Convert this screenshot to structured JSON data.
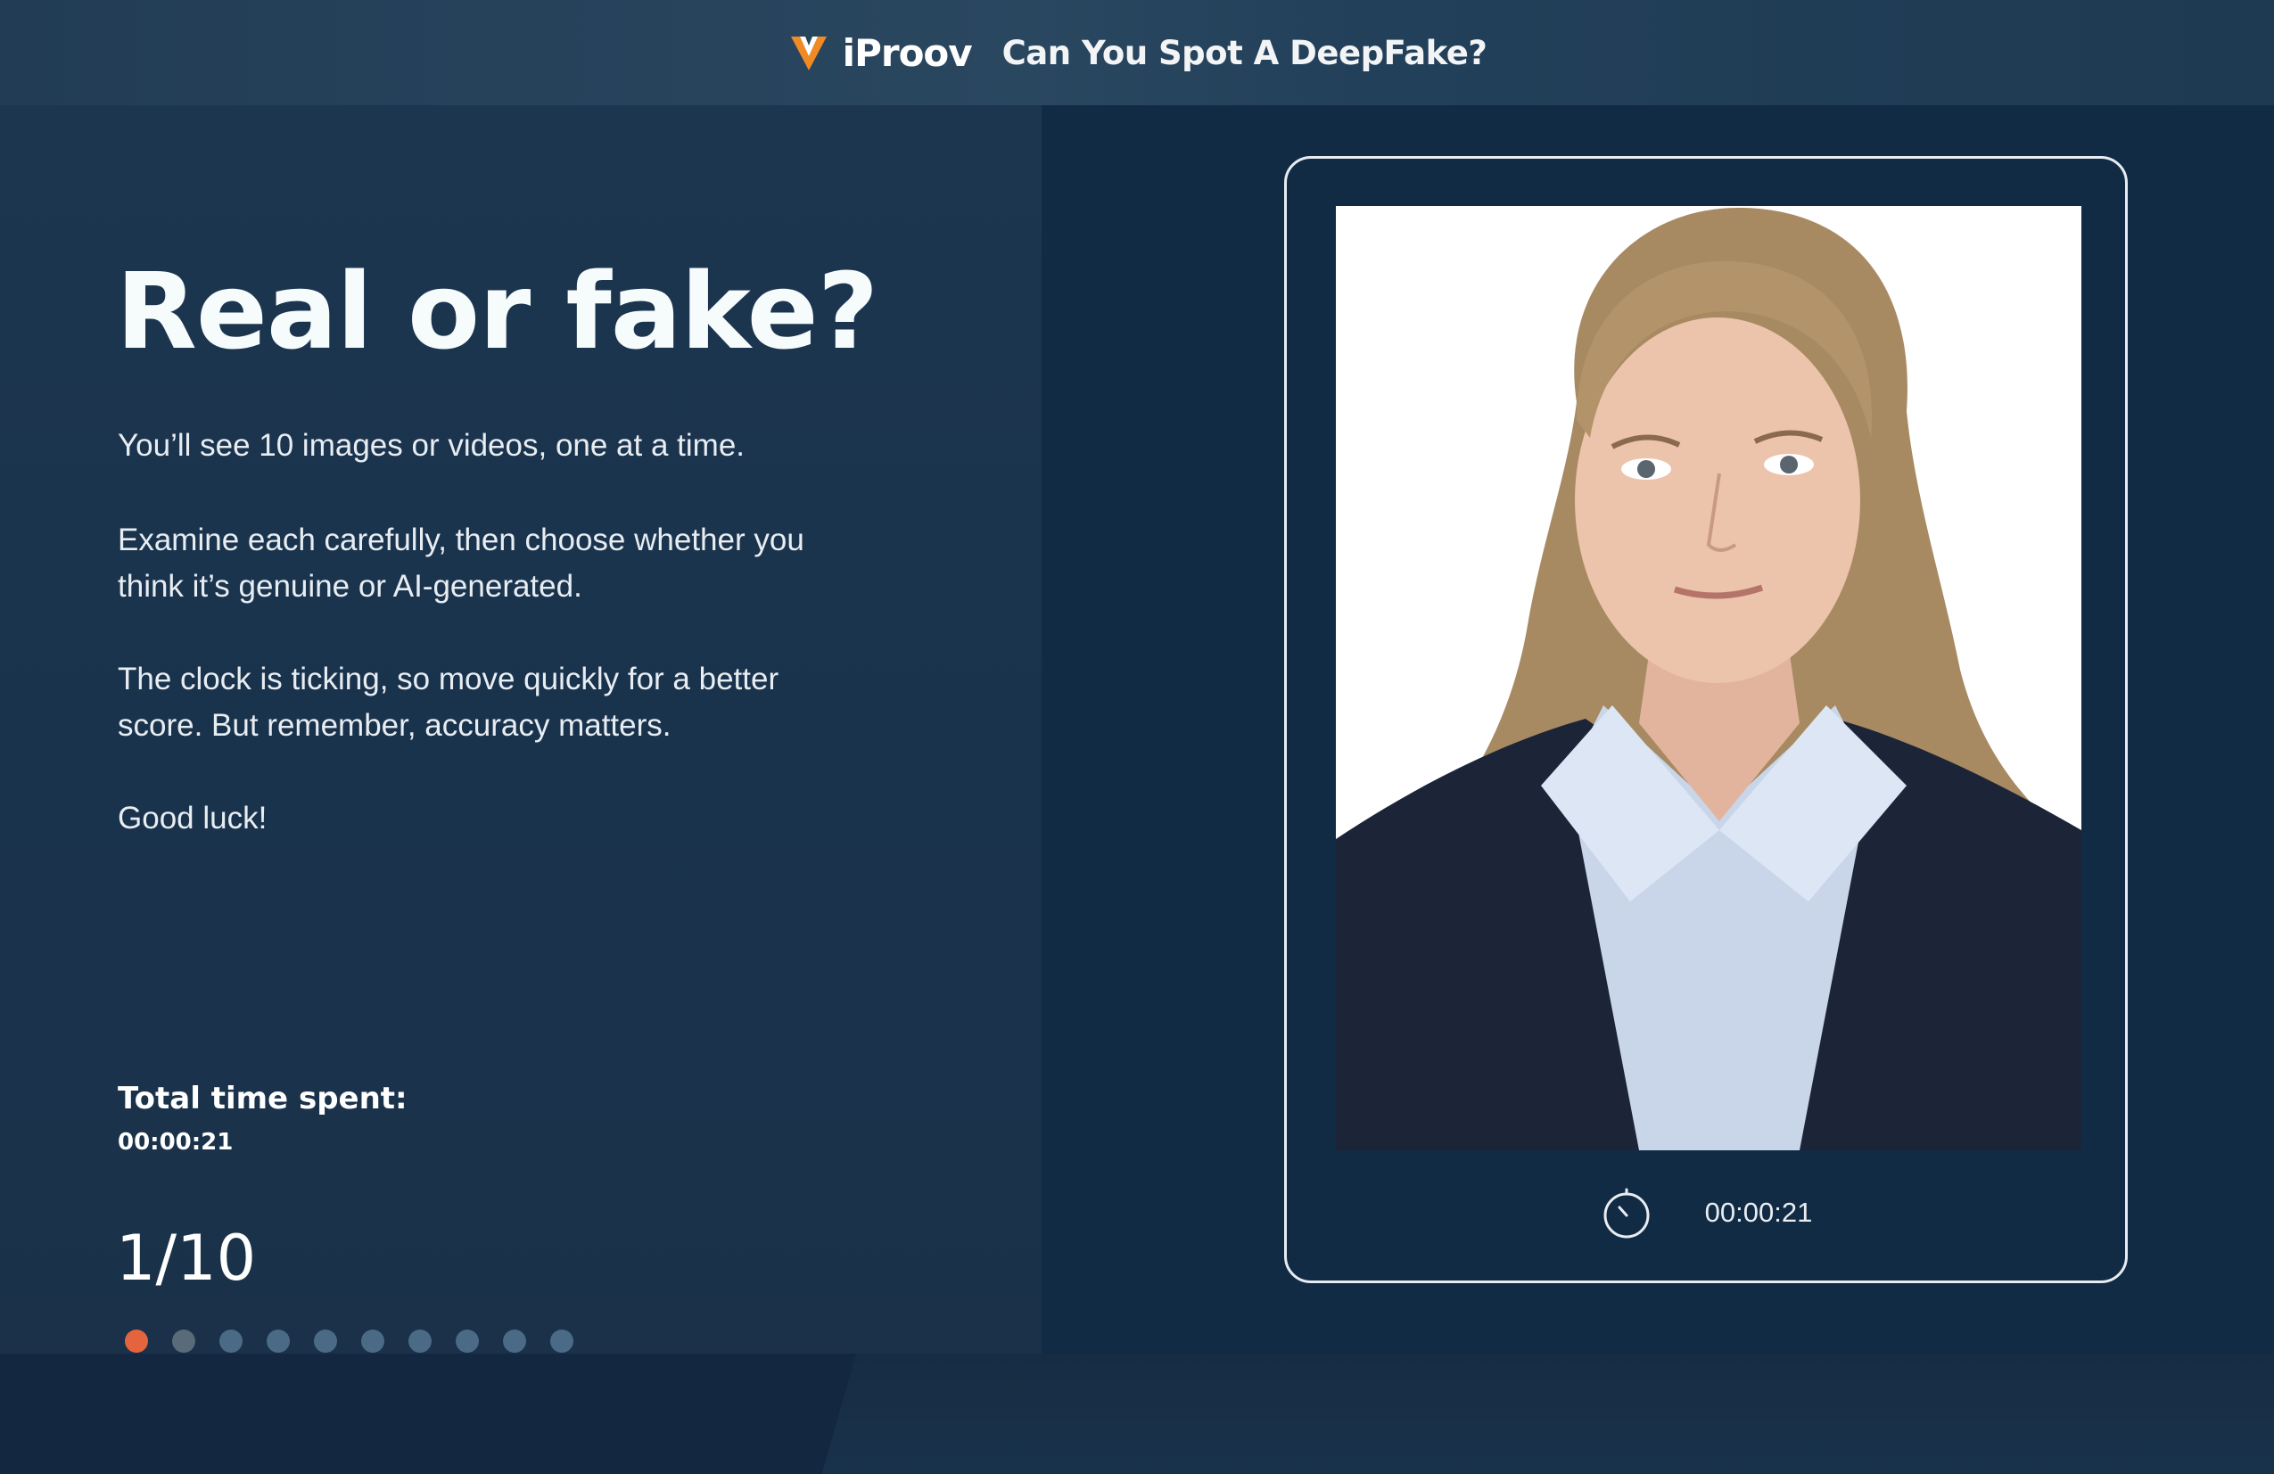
{
  "header": {
    "brand_name": "iProov",
    "title": "Can You Spot A DeepFake?"
  },
  "intro": {
    "heading": "Real or fake?",
    "paragraphs": [
      "You’ll see 10 images or videos, one at a time.",
      "Examine each carefully, then choose whether you think it’s genuine or AI-generated.",
      "The clock is ticking, so move quickly for a better score. But remember, accuracy matters.",
      "Good luck!"
    ]
  },
  "stats": {
    "time_label": "Total time spent:",
    "time_value": "00:00:21",
    "progress_text": "1/10",
    "current_index": 1,
    "total": 10
  },
  "card": {
    "timer_value": "00:00:21",
    "timer_icon": "stopwatch-icon"
  },
  "colors": {
    "accent": "#e3643d",
    "dot_inactive": "#4a6a86",
    "left_panel": "#1a334d",
    "right_panel": "#112b44"
  }
}
